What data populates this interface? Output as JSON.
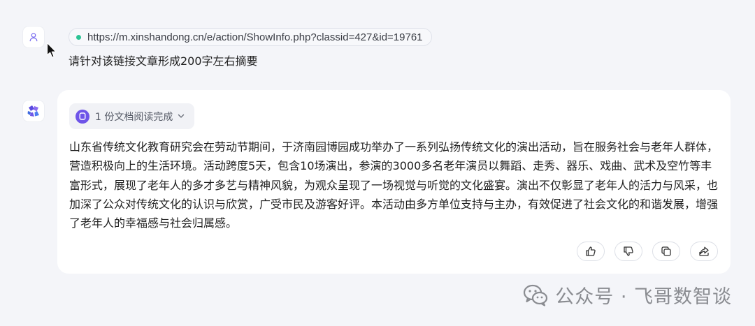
{
  "user_message": {
    "url": "https://m.xinshandong.cn/e/action/ShowInfo.php?classid=427&id=19761",
    "text": "请针对该链接文章形成200字左右摘要"
  },
  "assistant_message": {
    "doc_status": "1 份文档阅读完成",
    "answer": "山东省传统文化教育研究会在劳动节期间，于济南园博园成功举办了一系列弘扬传统文化的演出活动，旨在服务社会与老年人群体，营造积极向上的生活环境。活动跨度5天，包含10场演出，参演的3000多名老年演员以舞蹈、走秀、器乐、戏曲、武术及空竹等丰富形式，展现了老年人的多才多艺与精神风貌，为观众呈现了一场视觉与听觉的文化盛宴。演出不仅彰显了老年人的活力与风采，也加深了公众对传统文化的认识与欣赏，广受市民及游客好评。本活动由多方单位支持与主办，有效促进了社会文化的和谐发展，增强了老年人的幸福感与社会归属感。",
    "actions": [
      "thumbs-up",
      "thumbs-down",
      "copy",
      "share"
    ]
  },
  "watermark": {
    "text": "公众号 · 飞哥数智谈"
  },
  "colors": {
    "background": "#f4f5f9",
    "card": "#ffffff",
    "accent": "#6e54e8",
    "url_dot": "#2bc394",
    "watermark": "#8a8c91"
  }
}
